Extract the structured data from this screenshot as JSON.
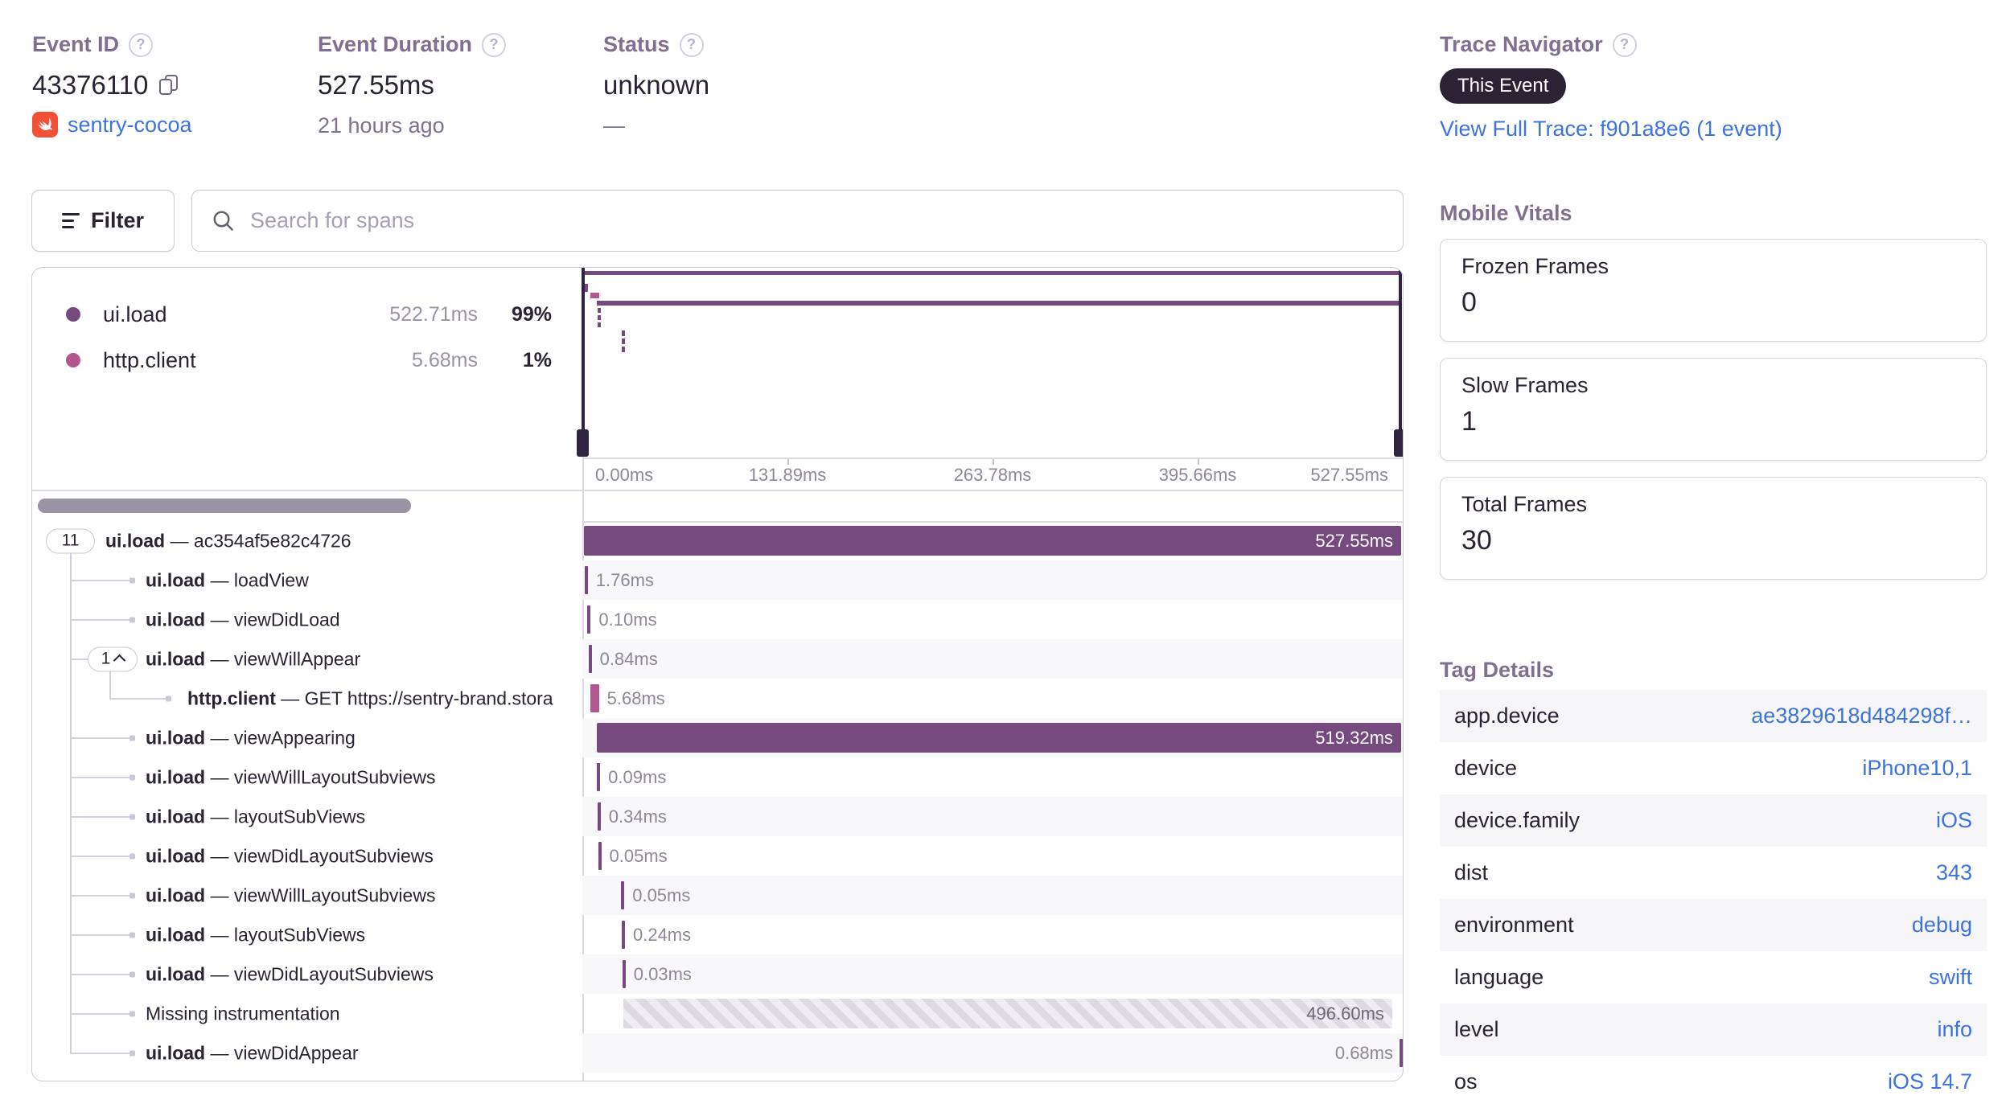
{
  "colors": {
    "purple": "#76497f",
    "pink": "#b0578f",
    "link": "#3d74db",
    "badge_bg": "#2b2233",
    "swift_orange": "#f05138",
    "dark": "#2b2233",
    "muted": "#80708f"
  },
  "header": {
    "event_id": {
      "label": "Event ID",
      "value": "43376110",
      "project": "sentry-cocoa"
    },
    "event_duration": {
      "label": "Event Duration",
      "value": "527.55ms",
      "ago": "21 hours ago"
    },
    "status": {
      "label": "Status",
      "value": "unknown",
      "sub": "—"
    },
    "trace_navigator": {
      "label": "Trace Navigator",
      "badge": "This Event",
      "link": "View Full Trace: f901a8e6 (1 event)"
    }
  },
  "toolbar": {
    "filter_label": "Filter",
    "search_placeholder": "Search for spans"
  },
  "legend": {
    "items": [
      {
        "name": "ui.load",
        "duration": "522.71ms",
        "pct": "99%",
        "color": "#76497f"
      },
      {
        "name": "http.client",
        "duration": "5.68ms",
        "pct": "1%",
        "color": "#b0578f"
      }
    ]
  },
  "minimap": {
    "axis_ticks": [
      "0.00ms",
      "131.89ms",
      "263.78ms",
      "395.66ms",
      "527.55ms"
    ],
    "total_ms": 527.55
  },
  "spans": [
    {
      "indent": 0,
      "count": "11",
      "chevron": false,
      "op": "ui.load",
      "desc": "ac354af5e82c4726",
      "duration": "527.55ms",
      "start_ms": 0,
      "dur_ms": 527.55,
      "render": "bar",
      "color": "purple"
    },
    {
      "indent": 1,
      "count": null,
      "chevron": false,
      "op": "ui.load",
      "desc": "loadView",
      "duration": "1.76ms",
      "start_ms": 0.4,
      "dur_ms": 1.76,
      "render": "tick",
      "color": "purple"
    },
    {
      "indent": 1,
      "count": null,
      "chevron": false,
      "op": "ui.load",
      "desc": "viewDidLoad",
      "duration": "0.10ms",
      "start_ms": 2.3,
      "dur_ms": 0.1,
      "render": "tick",
      "color": "purple"
    },
    {
      "indent": 1,
      "count": "1",
      "chevron": true,
      "op": "ui.load",
      "desc": "viewWillAppear",
      "duration": "0.84ms",
      "start_ms": 2.9,
      "dur_ms": 0.84,
      "render": "tick",
      "color": "purple"
    },
    {
      "indent": 2,
      "count": null,
      "chevron": false,
      "op": "http.client",
      "desc": "GET https://sentry-brand.stora",
      "duration": "5.68ms",
      "start_ms": 4.0,
      "dur_ms": 5.68,
      "render": "tick",
      "color": "pink"
    },
    {
      "indent": 1,
      "count": null,
      "chevron": false,
      "op": "ui.load",
      "desc": "viewAppearing",
      "duration": "519.32ms",
      "start_ms": 8.2,
      "dur_ms": 519.32,
      "render": "bar",
      "color": "purple"
    },
    {
      "indent": 1,
      "count": null,
      "chevron": false,
      "op": "ui.load",
      "desc": "viewWillLayoutSubviews",
      "duration": "0.09ms",
      "start_ms": 8.4,
      "dur_ms": 0.09,
      "render": "tick",
      "color": "purple"
    },
    {
      "indent": 1,
      "count": null,
      "chevron": false,
      "op": "ui.load",
      "desc": "layoutSubViews",
      "duration": "0.34ms",
      "start_ms": 8.7,
      "dur_ms": 0.34,
      "render": "tick",
      "color": "purple"
    },
    {
      "indent": 1,
      "count": null,
      "chevron": false,
      "op": "ui.load",
      "desc": "viewDidLayoutSubviews",
      "duration": "0.05ms",
      "start_ms": 9.1,
      "dur_ms": 0.05,
      "render": "tick",
      "color": "purple"
    },
    {
      "indent": 1,
      "count": null,
      "chevron": false,
      "op": "ui.load",
      "desc": "viewWillLayoutSubviews",
      "duration": "0.05ms",
      "start_ms": 24.0,
      "dur_ms": 0.05,
      "render": "tick",
      "color": "purple"
    },
    {
      "indent": 1,
      "count": null,
      "chevron": false,
      "op": "ui.load",
      "desc": "layoutSubViews",
      "duration": "0.24ms",
      "start_ms": 24.4,
      "dur_ms": 0.24,
      "render": "tick",
      "color": "purple"
    },
    {
      "indent": 1,
      "count": null,
      "chevron": false,
      "op": "ui.load",
      "desc": "viewDidLayoutSubviews",
      "duration": "0.03ms",
      "start_ms": 24.8,
      "dur_ms": 0.03,
      "render": "tick",
      "color": "purple"
    },
    {
      "indent": 1,
      "count": null,
      "chevron": false,
      "op": "",
      "desc": "Missing instrumentation",
      "duration": "496.60ms",
      "start_ms": 25.2,
      "dur_ms": 496.6,
      "render": "hatch",
      "color": "purple"
    },
    {
      "indent": 1,
      "count": null,
      "chevron": false,
      "op": "ui.load",
      "desc": "viewDidAppear",
      "duration": "0.68ms",
      "start_ms": 526.8,
      "dur_ms": 0.68,
      "render": "tick-end",
      "color": "purple"
    }
  ],
  "vitals": {
    "title": "Mobile Vitals",
    "cards": [
      {
        "label": "Frozen Frames",
        "value": "0"
      },
      {
        "label": "Slow Frames",
        "value": "1"
      },
      {
        "label": "Total Frames",
        "value": "30"
      }
    ]
  },
  "tags": {
    "title": "Tag Details",
    "rows": [
      {
        "key": "app.device",
        "value": "ae3829618d484298f…"
      },
      {
        "key": "device",
        "value": "iPhone10,1"
      },
      {
        "key": "device.family",
        "value": "iOS"
      },
      {
        "key": "dist",
        "value": "343"
      },
      {
        "key": "environment",
        "value": "debug"
      },
      {
        "key": "language",
        "value": "swift"
      },
      {
        "key": "level",
        "value": "info"
      },
      {
        "key": "os",
        "value": "iOS 14.7"
      }
    ]
  }
}
